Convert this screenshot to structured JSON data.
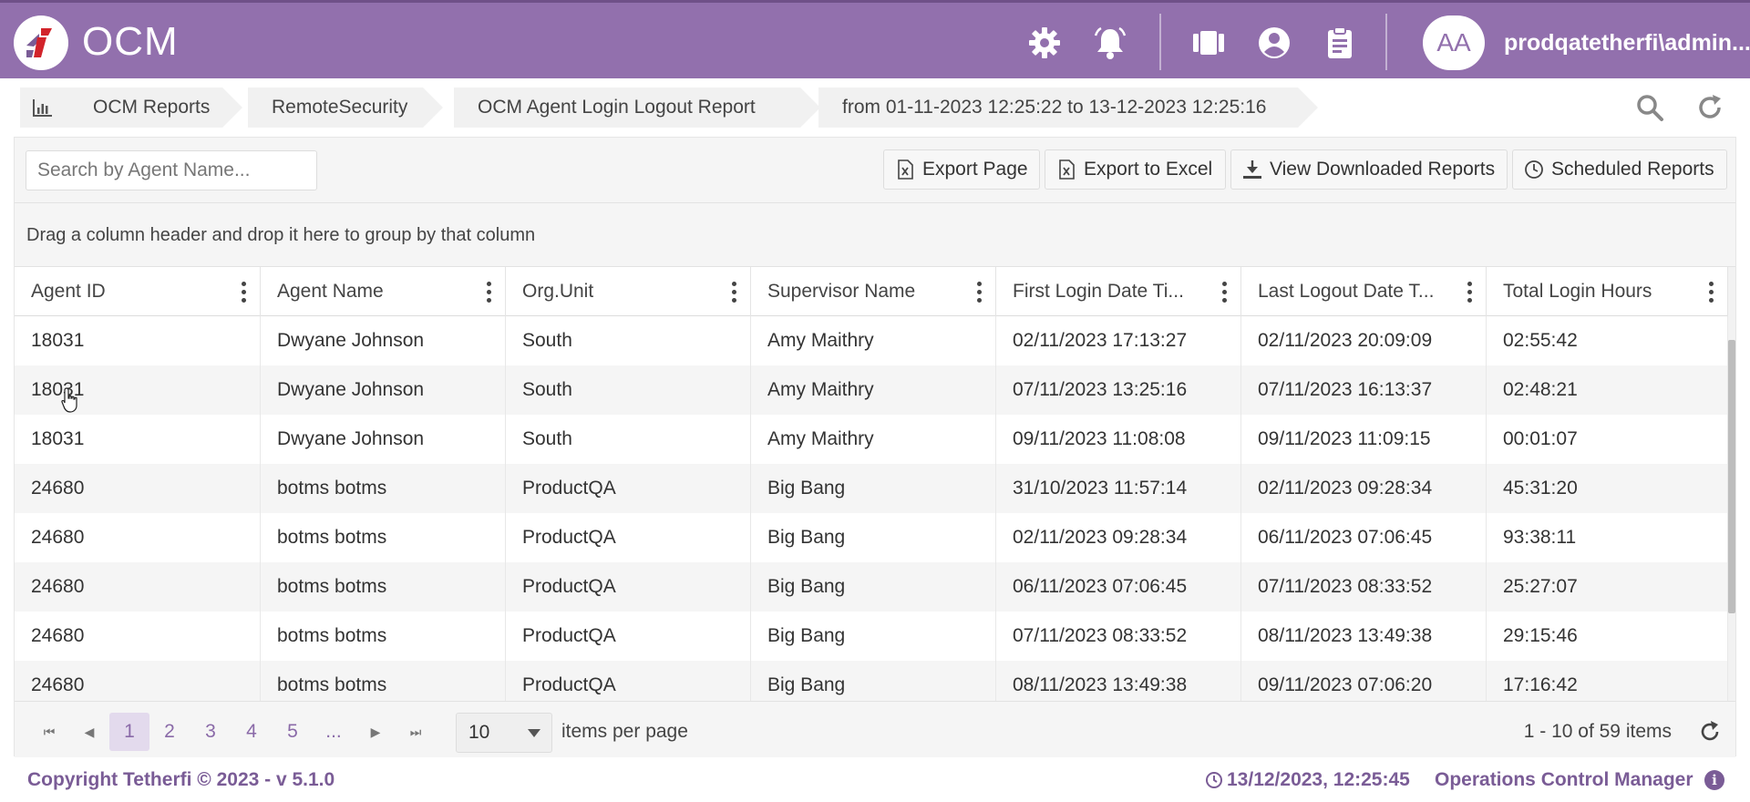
{
  "header": {
    "app_title": "OCM",
    "avatar_initials": "AA",
    "username": "prodqatetherfi\\admin...",
    "brand_color": "#9270ad",
    "icons": [
      "gear-icon",
      "bell-icon",
      "cards-icon",
      "user-circle-icon",
      "clipboard-icon"
    ]
  },
  "breadcrumb": {
    "items": [
      {
        "label": "OCM Reports",
        "icon": "bar-chart-icon"
      },
      {
        "label": "RemoteSecurity"
      },
      {
        "label": "OCM Agent Login Logout Report"
      },
      {
        "label": "from 01-11-2023 12:25:22 to 13-12-2023 12:25:16"
      }
    ]
  },
  "toolbar": {
    "search_placeholder": "Search by Agent Name...",
    "export_page": "Export Page",
    "export_excel": "Export to Excel",
    "view_downloaded": "View Downloaded Reports",
    "scheduled": "Scheduled Reports"
  },
  "group_hint": "Drag a column header and drop it here to group by that column",
  "table": {
    "columns": [
      "Agent ID",
      "Agent Name",
      "Org.Unit",
      "Supervisor Name",
      "First Login Date Ti...",
      "Last Logout Date T...",
      "Total Login Hours"
    ],
    "rows": [
      [
        "18031",
        "Dwyane Johnson",
        "South",
        "Amy Maithry",
        "02/11/2023 17:13:27",
        "02/11/2023 20:09:09",
        "02:55:42"
      ],
      [
        "18031",
        "Dwyane Johnson",
        "South",
        "Amy Maithry",
        "07/11/2023 13:25:16",
        "07/11/2023 16:13:37",
        "02:48:21"
      ],
      [
        "18031",
        "Dwyane Johnson",
        "South",
        "Amy Maithry",
        "09/11/2023 11:08:08",
        "09/11/2023 11:09:15",
        "00:01:07"
      ],
      [
        "24680",
        "botms botms",
        "ProductQA",
        "Big Bang",
        "31/10/2023 11:57:14",
        "02/11/2023 09:28:34",
        "45:31:20"
      ],
      [
        "24680",
        "botms botms",
        "ProductQA",
        "Big Bang",
        "02/11/2023 09:28:34",
        "06/11/2023 07:06:45",
        "93:38:11"
      ],
      [
        "24680",
        "botms botms",
        "ProductQA",
        "Big Bang",
        "06/11/2023 07:06:45",
        "07/11/2023 08:33:52",
        "25:27:07"
      ],
      [
        "24680",
        "botms botms",
        "ProductQA",
        "Big Bang",
        "07/11/2023 08:33:52",
        "08/11/2023 13:49:38",
        "29:15:46"
      ],
      [
        "24680",
        "botms botms",
        "ProductQA",
        "Big Bang",
        "08/11/2023 13:49:38",
        "09/11/2023 07:06:20",
        "17:16:42"
      ]
    ]
  },
  "pager": {
    "pages": [
      "1",
      "2",
      "3",
      "4",
      "5",
      "..."
    ],
    "active_page": "1",
    "page_size": "10",
    "items_per_page_label": "items per page",
    "summary": "1 - 10 of 59 items"
  },
  "footer": {
    "copyright": "Copyright Tetherfi © 2023 - v 5.1.0",
    "timestamp": "13/12/2023, 12:25:45",
    "app_name": "Operations Control Manager",
    "info": "i"
  }
}
